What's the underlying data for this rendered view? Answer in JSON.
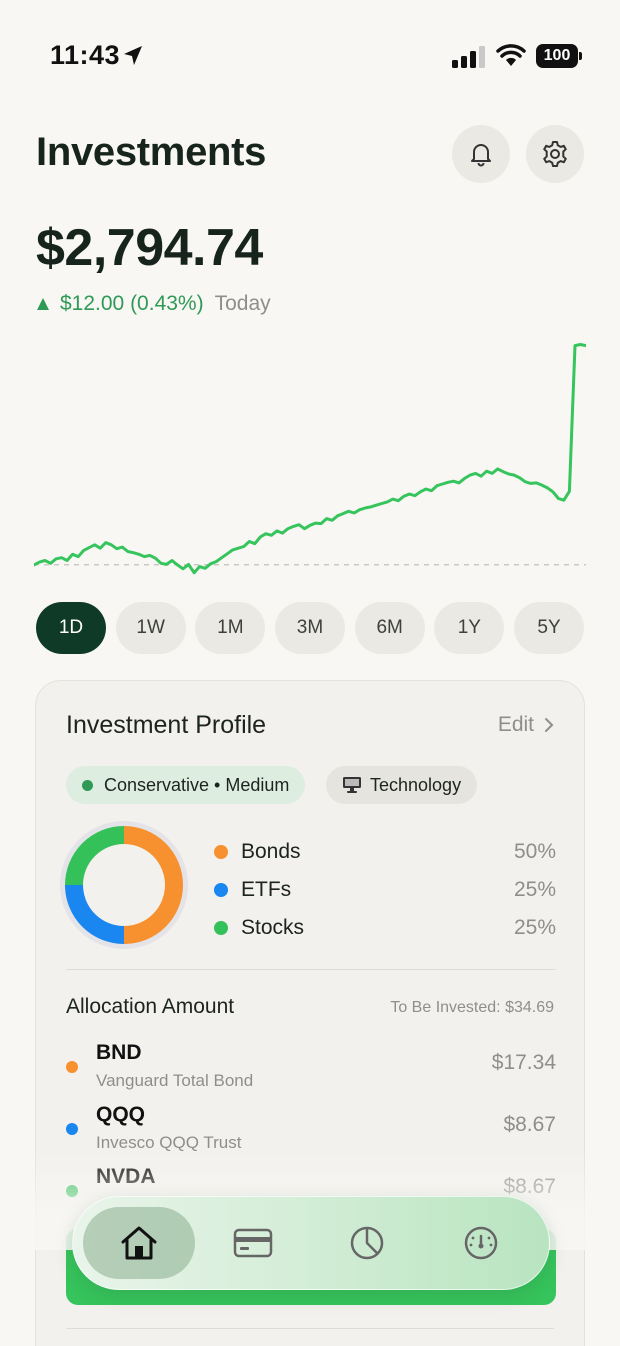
{
  "status_bar": {
    "time": "11:43",
    "battery": "100"
  },
  "header": {
    "title": "Investments"
  },
  "balance": {
    "amount": "$2,794.74",
    "change": "$12.00 (0.43%)",
    "period": "Today"
  },
  "colors": {
    "accent_green": "#2f9a55",
    "line_green": "#36c45c",
    "dark_green": "#0f3a28",
    "bonds": "#f7902e",
    "etfs": "#1a86f0",
    "stocks": "#35c15a"
  },
  "chart_data": {
    "type": "line",
    "x": [
      0,
      1,
      2,
      3,
      4,
      5,
      6,
      7,
      8,
      9,
      10,
      11,
      12,
      13,
      14,
      15,
      16,
      17,
      18,
      19,
      20,
      21,
      22,
      23,
      24,
      25,
      26,
      27,
      28,
      29,
      30,
      31,
      32,
      33,
      34,
      35,
      36,
      37,
      38,
      39,
      40,
      41,
      42,
      43,
      44,
      45,
      46,
      47,
      48,
      49,
      50,
      51,
      52,
      53,
      54,
      55,
      56,
      57,
      58,
      59,
      60,
      61,
      62,
      63,
      64,
      65,
      66,
      67,
      68,
      69,
      70,
      71,
      72,
      73,
      74,
      75,
      76,
      77,
      78,
      79,
      80,
      81,
      82,
      83,
      84,
      85,
      86,
      87,
      88,
      89,
      90,
      91,
      92,
      93,
      94,
      95,
      96,
      97,
      98,
      99,
      100
    ],
    "values": [
      2782.7,
      2783.2,
      2783.5,
      2783.0,
      2783.8,
      2784.0,
      2783.5,
      2784.6,
      2784.2,
      2785.3,
      2785.8,
      2786.3,
      2785.7,
      2786.7,
      2786.3,
      2785.6,
      2785.9,
      2785.1,
      2784.9,
      2784.6,
      2784.2,
      2784.4,
      2783.9,
      2783.0,
      2782.8,
      2783.5,
      2782.7,
      2782.0,
      2782.8,
      2781.3,
      2782.4,
      2782.1,
      2782.9,
      2783.3,
      2784.0,
      2784.7,
      2785.4,
      2785.7,
      2786.0,
      2786.9,
      2786.5,
      2787.7,
      2788.3,
      2788.0,
      2788.8,
      2788.4,
      2789.2,
      2789.6,
      2789.9,
      2789.2,
      2789.8,
      2790.2,
      2790.1,
      2791.0,
      2790.7,
      2791.5,
      2791.9,
      2792.3,
      2792.0,
      2792.6,
      2792.9,
      2793.1,
      2793.4,
      2793.7,
      2794.0,
      2794.5,
      2794.2,
      2795.0,
      2795.4,
      2795.1,
      2795.8,
      2796.3,
      2796.0,
      2796.9,
      2797.2,
      2797.5,
      2797.7,
      2797.4,
      2798.2,
      2798.8,
      2799.1,
      2798.6,
      2799.5,
      2799.1,
      2799.9,
      2799.4,
      2799.0,
      2798.8,
      2798.3,
      2797.6,
      2797.3,
      2797.4,
      2797.0,
      2796.5,
      2795.8,
      2794.6,
      2794.3,
      2795.9,
      2822.0,
      2822.2,
      2822.0
    ],
    "baseline": 2782.74,
    "ylim": [
      2780,
      2823
    ],
    "grid": false
  },
  "periods": [
    "1D",
    "1W",
    "1M",
    "3M",
    "6M",
    "1Y",
    "5Y"
  ],
  "active_period": "1D",
  "profile": {
    "title": "Investment Profile",
    "edit_label": "Edit",
    "risk_chip": "Conservative • Medium",
    "sector_chip": "Technology",
    "allocation": [
      {
        "name": "Bonds",
        "percent": "50%",
        "value": 50,
        "color": "#f7902e"
      },
      {
        "name": "ETFs",
        "percent": "25%",
        "value": 25,
        "color": "#1a86f0"
      },
      {
        "name": "Stocks",
        "percent": "25%",
        "value": 25,
        "color": "#35c15a"
      }
    ],
    "allocation_title": "Allocation Amount",
    "to_be_invested": "To Be Invested: $34.69",
    "holdings": [
      {
        "ticker": "BND",
        "name": "Vanguard Total Bond",
        "amount": "$17.34",
        "color": "#f7902e"
      },
      {
        "ticker": "QQQ",
        "name": "Invesco QQQ Trust",
        "amount": "$8.67",
        "color": "#1a86f0"
      },
      {
        "ticker": "NVDA",
        "name": "",
        "amount": "$8.67",
        "color": "#35c15a"
      }
    ]
  },
  "tabbar": {
    "tabs": [
      {
        "icon": "home-icon",
        "active": true
      },
      {
        "icon": "card-icon",
        "active": false
      },
      {
        "icon": "pie-chart-icon",
        "active": false
      },
      {
        "icon": "gauge-icon",
        "active": false
      }
    ]
  }
}
